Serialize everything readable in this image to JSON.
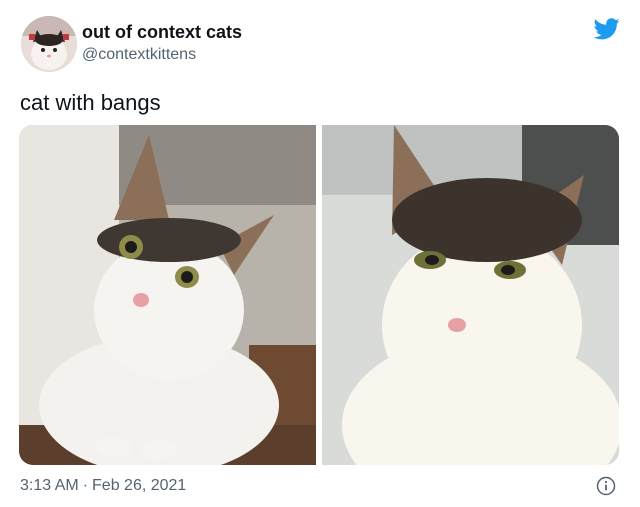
{
  "author": {
    "display_name": "out of context cats",
    "handle": "@contextkittens",
    "avatar_icon": "cat-avatar"
  },
  "brand": {
    "logo_icon": "twitter-bird-icon",
    "color": "#1d9bf0"
  },
  "tweet": {
    "text": "cat with bangs"
  },
  "media": {
    "images": [
      {
        "name": "cat-photo-left"
      },
      {
        "name": "cat-photo-right"
      }
    ]
  },
  "meta": {
    "time": "3:13 AM",
    "separator": "·",
    "date": "Feb 26, 2021",
    "info_icon": "info-icon"
  }
}
